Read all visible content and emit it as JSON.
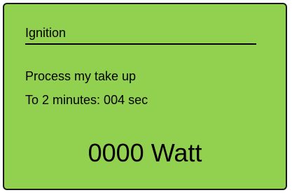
{
  "display": {
    "title": "Ignition",
    "line1": "Process my take up",
    "line2": "To 2 minutes:  004 sec",
    "power": "0000 Watt"
  },
  "colors": {
    "panel_background": "#92d050",
    "panel_border": "#1a1a1a",
    "text": "#000000"
  }
}
